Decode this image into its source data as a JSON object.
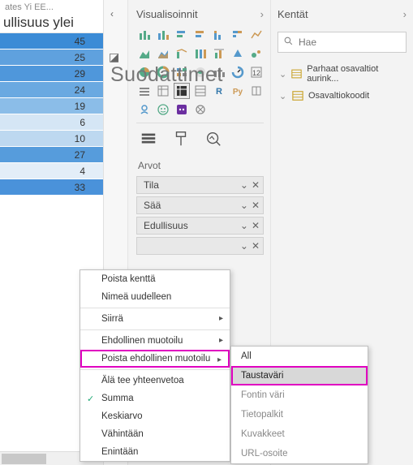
{
  "left": {
    "header": "ates Yi EE...",
    "subheader": "ullisuus ylei",
    "rows": [
      {
        "v": 45,
        "bg": "#3b8bd6"
      },
      {
        "v": 25,
        "bg": "#5fa1de"
      },
      {
        "v": 29,
        "bg": "#4f97db"
      },
      {
        "v": 24,
        "bg": "#6aa9e1"
      },
      {
        "v": 19,
        "bg": "#8bbde8"
      },
      {
        "v": 6,
        "bg": "#d5e6f5"
      },
      {
        "v": 10,
        "bg": "#bdd8f0"
      },
      {
        "v": 27,
        "bg": "#569cdc"
      },
      {
        "v": 4,
        "bg": "#e3eef8"
      },
      {
        "v": 33,
        "bg": "#4a92da"
      }
    ]
  },
  "viz": {
    "title": "Visualisoinnit",
    "overlay": "Suodattimet",
    "values_label": "Arvot",
    "wells": [
      {
        "label": "Tila"
      },
      {
        "label": "Sää"
      },
      {
        "label": "Edullisuus"
      },
      {
        "label": ""
      }
    ]
  },
  "fields": {
    "title": "Kentät",
    "search_placeholder": "Hae",
    "tables": [
      {
        "name": "Parhaat osavaltiot aurink..."
      },
      {
        "name": "Osavaltiokoodit"
      }
    ]
  },
  "ctx": {
    "remove": "Poista kenttä",
    "rename": "Nimeä uudelleen",
    "move": "Siirrä",
    "cond": "Ehdollinen muotoilu",
    "remcond": "Poista ehdollinen muotoilu",
    "nosum": "Älä tee yhteenvetoa",
    "sum": "Summa",
    "avg": "Keskiarvo",
    "min": "Vähintään",
    "max": "Enintään"
  },
  "sub": {
    "all": "All",
    "bg": "Taustaväri",
    "font": "Fontin väri",
    "bars": "Tietopalkit",
    "icons": "Kuvakkeet",
    "url": "URL-osoite"
  }
}
